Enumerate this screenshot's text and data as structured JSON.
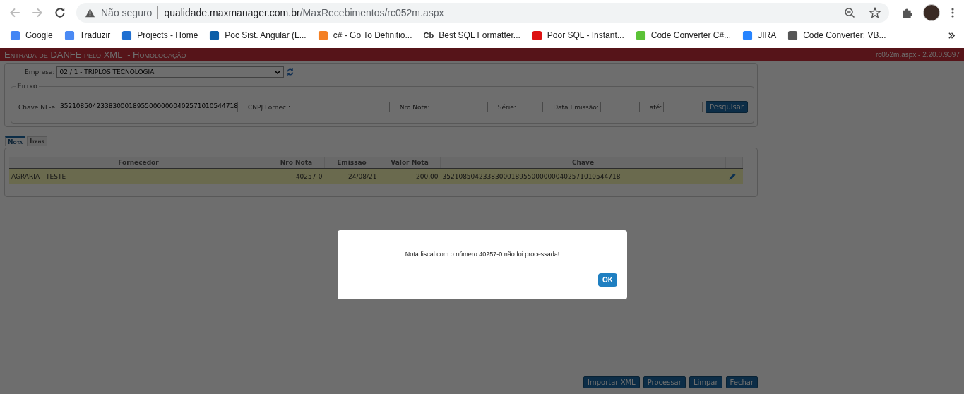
{
  "browser": {
    "security": "Não seguro",
    "host": "qualidade.maxmanager.com.br",
    "path": "/MaxRecebimentos/rc052m.aspx"
  },
  "bookmarks": [
    {
      "label": "Google"
    },
    {
      "label": "Traduzir"
    },
    {
      "label": "Projects - Home"
    },
    {
      "label": "Poc Sist. Angular (L..."
    },
    {
      "label": "c# - Go To Definitio..."
    },
    {
      "label": "Best SQL Formatter...",
      "badge": "Cb"
    },
    {
      "label": "Poor SQL - Instant..."
    },
    {
      "label": "Code Converter C#..."
    },
    {
      "label": "JIRA"
    },
    {
      "label": "Code Converter: VB..."
    }
  ],
  "app_header": {
    "title": "Entrada de DANFE pelo XML  - Homologação",
    "version": "rc052m.aspx - 2.20.0.9397"
  },
  "empresa": {
    "label": "Empresa:",
    "value": "02 / 1 - TRIPLOS TECNOLOGIA"
  },
  "filter": {
    "legend": "Filtro",
    "fields": [
      {
        "label": "Chave NF-e:",
        "value": "35210850423383000189550000000402571010544718"
      },
      {
        "label": "CNPJ Fornec.:"
      },
      {
        "label": "Nro Nota:"
      },
      {
        "label": "Série:"
      },
      {
        "label": "Data Emissão:"
      },
      {
        "label": "até:"
      }
    ],
    "button": "Pesquisar"
  },
  "tabs": [
    {
      "label": "Nota",
      "selected": true
    },
    {
      "label": "Itens",
      "selected": false
    }
  ],
  "table": {
    "columns": [
      "Fornecedor",
      "Nro Nota",
      "Emissão",
      "Valor Nota",
      "Chave"
    ],
    "rows": [
      {
        "cells": [
          "AGRARIA - TESTE",
          "40257-0",
          "24/08/21",
          "200,00",
          "35210850423383000189550000000402571010544718"
        ],
        "selected": true
      }
    ]
  },
  "dialog": {
    "message": "Nota fiscal com o número 40257-0 não foi processada!",
    "button": "OK"
  },
  "actions": [
    "Importar XML",
    "Processar",
    "Limpar",
    "Fechar"
  ]
}
